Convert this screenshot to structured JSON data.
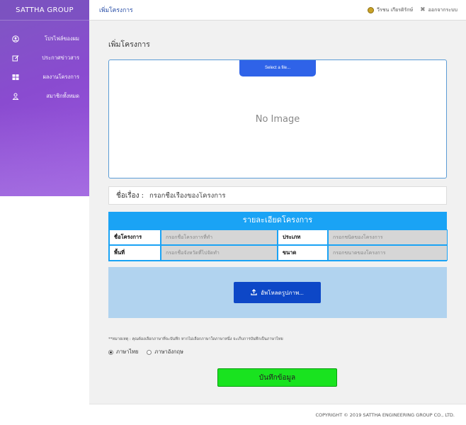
{
  "brand": "SATTHA GROUP",
  "sidebar": {
    "items": [
      {
        "icon": "user-circle-icon",
        "label": "โปรไฟล์ของผม"
      },
      {
        "icon": "edit-icon",
        "label": "ประกาศข่าวสาร"
      },
      {
        "icon": "grid-icon",
        "label": "ผลงานโครงการ"
      },
      {
        "icon": "person-icon",
        "label": "สมาชิกทั้งหมด"
      }
    ]
  },
  "header": {
    "breadcrumb": "เพิ่มโครงการ",
    "user_name": "วีรชน เกียรติรักษ์",
    "logout": "ออกจากระบบ"
  },
  "main": {
    "page_title": "เพิ่มโครงการ",
    "select_file": "Select a file...",
    "no_image": "No Image",
    "title_label": "ชื่อเรื่อง :",
    "title_placeholder": "กรอกชื่อเรื่องของโครงการ",
    "detail_heading": "รายละเอียดโครงการ",
    "rows": [
      {
        "label1": "ชื่อโครงการ",
        "placeholder1": "กรอกชื่อโครงการที่ทำ",
        "label2": "ประเภท",
        "placeholder2": "กรอกชนิดของโครงการ"
      },
      {
        "label1": "พื้นที่",
        "placeholder1": "กรอกชื่อจังหวัดที่ไปจัดทำ",
        "label2": "ขนาด",
        "placeholder2": "กรอกขนาดของโครงการ"
      }
    ],
    "upload_button": "อัพโหลดรูปภาพ...",
    "note": "**หมายเหตุ : คุณต้องเลือกภาษาที่จะบันทึก หากไม่เลือกภาษาใดภาษาหนึ่ง จะเก็บการบันทึกเป็นภาษาไทย",
    "lang_thai": "ภาษาไทย",
    "lang_english": "ภาษาอังกฤษ",
    "save_button": "บันทึกข้อมูล"
  },
  "footer": {
    "copyright": "COPYRIGHT © 2019 SATTHA ENGINEERING GROUP CO., LTD."
  },
  "colors": {
    "sidebar": "#8a4bd0",
    "accent_blue": "#1aa3f5",
    "upload_bg": "#b1d3ef",
    "save_green": "#19e31f"
  }
}
